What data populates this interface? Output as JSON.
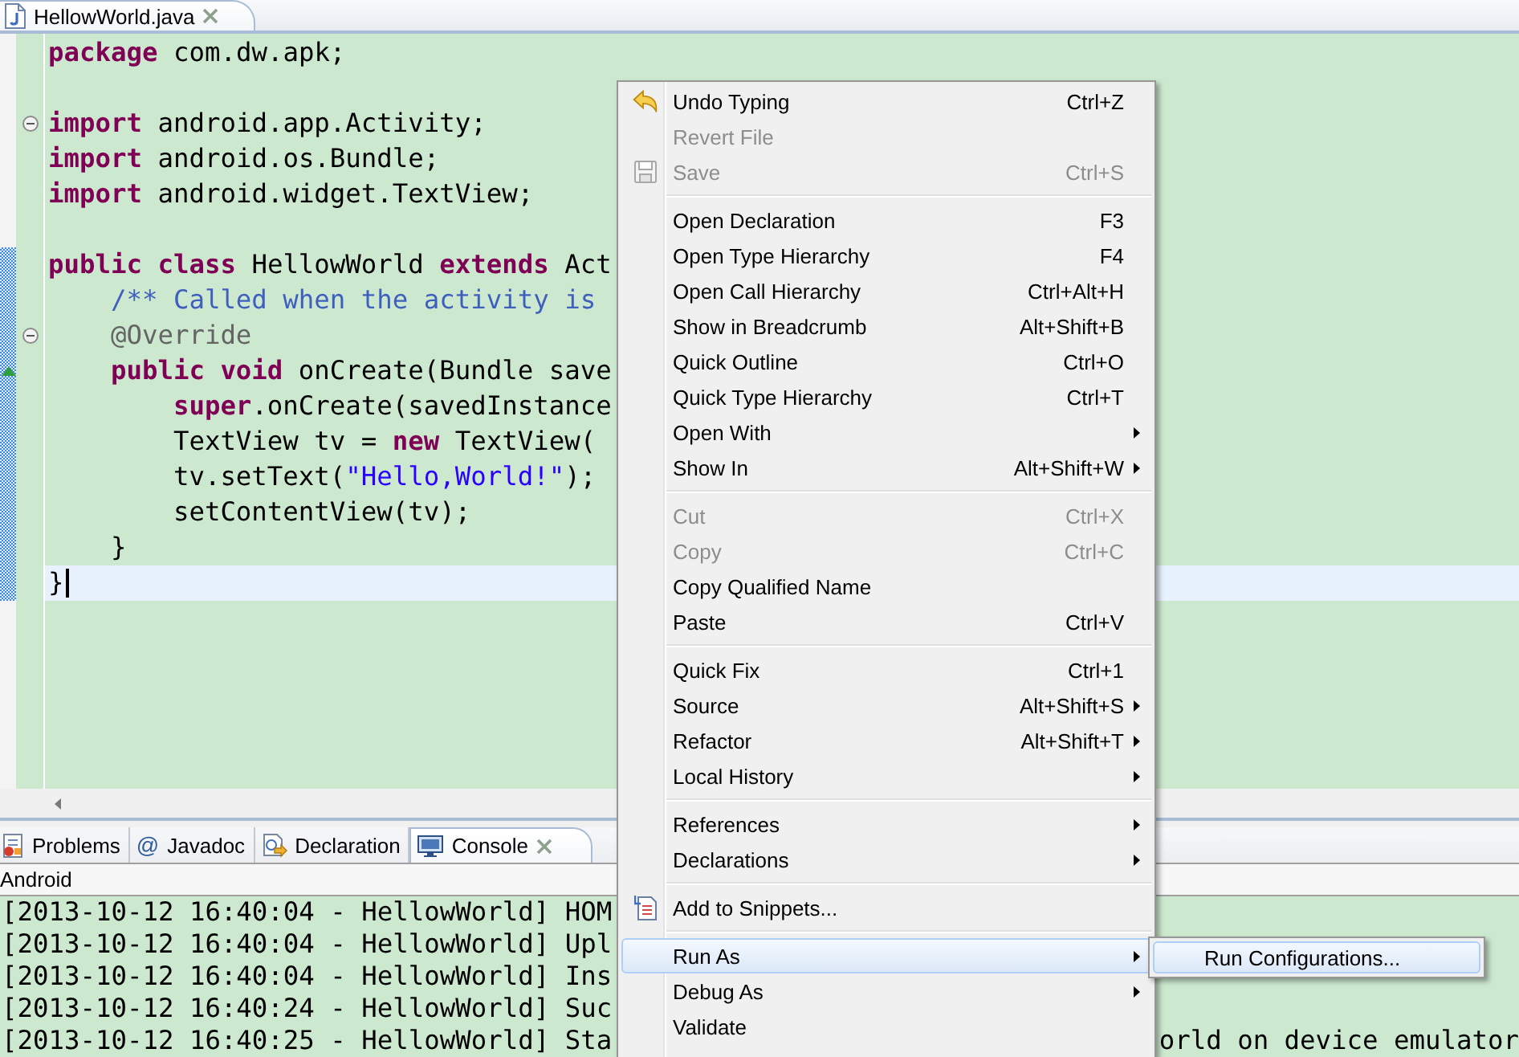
{
  "editor_tabs": [
    {
      "label": "HellowWorld.java",
      "selected": true
    }
  ],
  "code": {
    "lines": [
      {
        "kind": "code",
        "tokens": [
          {
            "kind": "keyword",
            "text": "package"
          },
          {
            "kind": "plain",
            "text": " com.dw.apk;"
          }
        ],
        "changed": false,
        "current": false,
        "override": false
      },
      {
        "kind": "blank"
      },
      {
        "kind": "code",
        "tokens": [
          {
            "kind": "keyword",
            "text": "import"
          },
          {
            "kind": "plain",
            "text": " android.app.Activity;"
          }
        ],
        "changed": false,
        "current": false,
        "override": false,
        "expanded": true
      },
      {
        "kind": "code",
        "tokens": [
          {
            "kind": "keyword",
            "text": "import"
          },
          {
            "kind": "plain",
            "text": " android.os.Bundle;"
          }
        ],
        "changed": false,
        "current": false,
        "override": false
      },
      {
        "kind": "code",
        "tokens": [
          {
            "kind": "keyword",
            "text": "import"
          },
          {
            "kind": "plain",
            "text": " android.widget.TextView;"
          }
        ],
        "changed": false,
        "current": false,
        "override": false
      },
      {
        "kind": "blank"
      },
      {
        "kind": "code",
        "tokens": [
          {
            "kind": "keyword",
            "text": "public class"
          },
          {
            "kind": "plain",
            "text": " HellowWorld "
          },
          {
            "kind": "keyword",
            "text": "extends"
          },
          {
            "kind": "plain",
            "text": " Act"
          }
        ],
        "changed": true,
        "current": false,
        "override": false,
        "children": [
          {
            "kind": "code",
            "tokens": [
              {
                "kind": "comment",
                "text": "/** Called when the activity is"
              }
            ],
            "changed": true,
            "current": false,
            "override": false
          },
          {
            "kind": "code",
            "tokens": [
              {
                "kind": "annotation",
                "text": "@Override"
              }
            ],
            "changed": true,
            "current": false,
            "override": false,
            "expanded": true
          },
          {
            "kind": "code",
            "tokens": [
              {
                "kind": "keyword",
                "text": "public void"
              },
              {
                "kind": "plain",
                "text": " onCreate(Bundle save"
              }
            ],
            "changed": true,
            "current": false,
            "override": true,
            "children": [
              {
                "kind": "code",
                "tokens": [
                  {
                    "kind": "keyword",
                    "text": "super"
                  },
                  {
                    "kind": "plain",
                    "text": ".onCreate(savedInstance"
                  }
                ],
                "changed": true,
                "current": false,
                "override": false
              },
              {
                "kind": "code",
                "tokens": [
                  {
                    "kind": "plain",
                    "text": "TextView tv = "
                  },
                  {
                    "kind": "keyword",
                    "text": "new"
                  },
                  {
                    "kind": "plain",
                    "text": " TextView("
                  }
                ],
                "changed": true,
                "current": false,
                "override": false
              },
              {
                "kind": "code",
                "tokens": [
                  {
                    "kind": "plain",
                    "text": "tv.setText("
                  },
                  {
                    "kind": "string",
                    "text": "\"Hello,World!\""
                  },
                  {
                    "kind": "plain",
                    "text": ");"
                  }
                ],
                "changed": true,
                "current": false,
                "override": false
              },
              {
                "kind": "code",
                "tokens": [
                  {
                    "kind": "plain",
                    "text": "setContentView(tv);"
                  }
                ],
                "changed": true,
                "current": false,
                "override": false
              }
            ]
          },
          {
            "kind": "code",
            "tokens": [
              {
                "kind": "plain",
                "text": "}"
              }
            ],
            "changed": true,
            "current": false,
            "override": false
          }
        ]
      },
      {
        "kind": "code",
        "tokens": [
          {
            "kind": "plain",
            "text": "}"
          }
        ],
        "changed": true,
        "current": true,
        "override": false
      }
    ]
  },
  "panel_tabs": [
    {
      "kind": "problems",
      "label": "Problems",
      "selected": false
    },
    {
      "kind": "javadoc",
      "glyph": "@",
      "label": "Javadoc",
      "selected": false
    },
    {
      "kind": "declaration",
      "label": "Declaration",
      "selected": false
    },
    {
      "kind": "console",
      "label": "Console",
      "selected": true
    }
  ],
  "console": {
    "name": "Android",
    "lines": [
      {
        "text": "[2013-10-12 16:40:04 - HellowWorld] HOM"
      },
      {
        "text": "[2013-10-12 16:40:04 - HellowWorld] Upl"
      },
      {
        "text": "[2013-10-12 16:40:04 - HellowWorld] Ins"
      },
      {
        "text": "[2013-10-12 16:40:24 - HellowWorld] Suc"
      },
      {
        "text": "[2013-10-12 16:40:25 - HellowWorld] Sta",
        "tail": "orld on device emulator"
      }
    ]
  },
  "context_menu": {
    "items": [
      {
        "kind": "item",
        "label": "Undo Typing",
        "shortcut": "Ctrl+Z",
        "disabled": false,
        "selected": false,
        "arrow": false
      },
      {
        "kind": "item",
        "label": "Revert File",
        "disabled": true,
        "selected": false,
        "arrow": false
      },
      {
        "kind": "item",
        "label": "Save",
        "shortcut": "Ctrl+S",
        "disabled": true,
        "selected": false,
        "arrow": false
      },
      {
        "kind": "separator"
      },
      {
        "kind": "item",
        "label": "Open Declaration",
        "shortcut": "F3",
        "disabled": false,
        "selected": false,
        "arrow": false
      },
      {
        "kind": "item",
        "label": "Open Type Hierarchy",
        "shortcut": "F4",
        "disabled": false,
        "selected": false,
        "arrow": false
      },
      {
        "kind": "item",
        "label": "Open Call Hierarchy",
        "shortcut": "Ctrl+Alt+H",
        "disabled": false,
        "selected": false,
        "arrow": false
      },
      {
        "kind": "item",
        "label": "Show in Breadcrumb",
        "shortcut": "Alt+Shift+B",
        "disabled": false,
        "selected": false,
        "arrow": false
      },
      {
        "kind": "item",
        "label": "Quick Outline",
        "shortcut": "Ctrl+O",
        "disabled": false,
        "selected": false,
        "arrow": false
      },
      {
        "kind": "item",
        "label": "Quick Type Hierarchy",
        "shortcut": "Ctrl+T",
        "disabled": false,
        "selected": false,
        "arrow": false
      },
      {
        "kind": "item",
        "label": "Open With",
        "disabled": false,
        "selected": false,
        "arrow": true
      },
      {
        "kind": "item",
        "label": "Show In",
        "shortcut": "Alt+Shift+W",
        "disabled": false,
        "selected": false,
        "arrow": true
      },
      {
        "kind": "separator"
      },
      {
        "kind": "item",
        "label": "Cut",
        "shortcut": "Ctrl+X",
        "disabled": true,
        "selected": false,
        "arrow": false
      },
      {
        "kind": "item",
        "label": "Copy",
        "shortcut": "Ctrl+C",
        "disabled": true,
        "selected": false,
        "arrow": false
      },
      {
        "kind": "item",
        "label": "Copy Qualified Name",
        "disabled": false,
        "selected": false,
        "arrow": false
      },
      {
        "kind": "item",
        "label": "Paste",
        "shortcut": "Ctrl+V",
        "disabled": false,
        "selected": false,
        "arrow": false
      },
      {
        "kind": "separator"
      },
      {
        "kind": "item",
        "label": "Quick Fix",
        "shortcut": "Ctrl+1",
        "disabled": false,
        "selected": false,
        "arrow": false
      },
      {
        "kind": "item",
        "label": "Source",
        "shortcut": "Alt+Shift+S",
        "disabled": false,
        "selected": false,
        "arrow": true
      },
      {
        "kind": "item",
        "label": "Refactor",
        "shortcut": "Alt+Shift+T",
        "disabled": false,
        "selected": false,
        "arrow": true
      },
      {
        "kind": "item",
        "label": "Local History",
        "disabled": false,
        "selected": false,
        "arrow": true
      },
      {
        "kind": "separator"
      },
      {
        "kind": "item",
        "label": "References",
        "disabled": false,
        "selected": false,
        "arrow": true
      },
      {
        "kind": "item",
        "label": "Declarations",
        "disabled": false,
        "selected": false,
        "arrow": true
      },
      {
        "kind": "separator"
      },
      {
        "kind": "item",
        "label": "Add to Snippets...",
        "disabled": false,
        "selected": false,
        "arrow": false
      },
      {
        "kind": "separator"
      },
      {
        "kind": "item",
        "label": "Run As",
        "disabled": false,
        "selected": true,
        "arrow": true,
        "submenu": {
          "items": [
            {
              "label": "Run Configurations...",
              "selected": true
            }
          ]
        }
      },
      {
        "kind": "item",
        "label": "Debug As",
        "disabled": false,
        "selected": false,
        "arrow": true
      },
      {
        "kind": "item",
        "label": "Validate",
        "disabled": false,
        "selected": false,
        "arrow": false
      }
    ]
  }
}
